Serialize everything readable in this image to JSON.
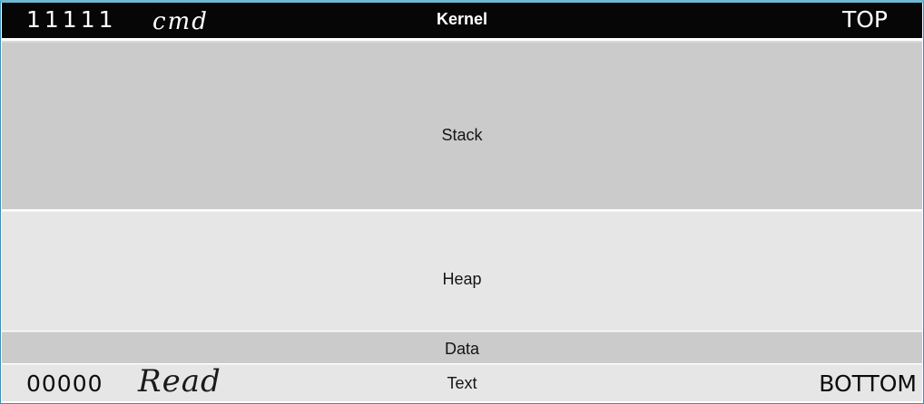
{
  "segments": {
    "kernel": "Kernel",
    "stack": "Stack",
    "heap": "Heap",
    "data": "Data",
    "text": "Text"
  },
  "addresses": {
    "top": "11111",
    "bottom": "00000"
  },
  "positions": {
    "top": "TOP",
    "bottom": "BOTTOM"
  },
  "handwritten": {
    "top": "cmd",
    "bottom": "Read"
  }
}
